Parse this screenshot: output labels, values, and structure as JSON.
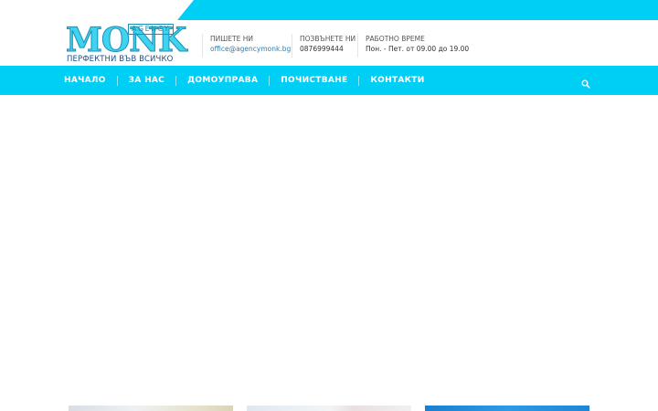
{
  "logo": {
    "name": "MONK",
    "badge": "AGENCY",
    "tagline": "ПЕРФЕКТНИ ВЪВ ВСИЧКО"
  },
  "contacts": [
    {
      "label": "ПИШЕТЕ НИ",
      "value": "office@agencymonk.bg"
    },
    {
      "label": "ПОЗВЪНЕТЕ НИ",
      "value": "0876999444"
    },
    {
      "label": "РАБОТНО ВРЕМЕ",
      "value": "Пон. - Пет. от 09.00 до 19.00"
    }
  ],
  "nav": {
    "items": [
      {
        "label": "НАЧАЛО"
      },
      {
        "label": "ЗА НАС"
      },
      {
        "label": "ДОМОУПРАВА"
      },
      {
        "label": "ПОЧИСТВАНЕ"
      },
      {
        "label": "КОНТАКТИ"
      }
    ],
    "search_icon": "search-icon"
  },
  "colors": {
    "accent": "#00cff5",
    "logo": "#3fd3ef",
    "link": "#2f7fb3"
  }
}
